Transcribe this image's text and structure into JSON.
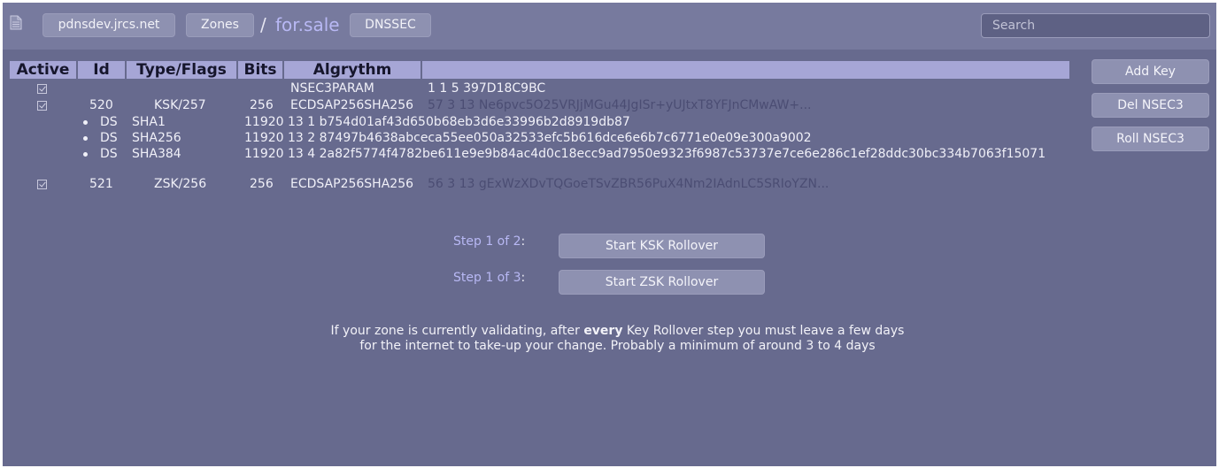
{
  "header": {
    "server_button": "pdnsdev.jrcs.net",
    "zones_button": "Zones",
    "separator": "/",
    "zone_name": "for.sale",
    "dnssec_button": "DNSSEC",
    "search_placeholder": "Search"
  },
  "table": {
    "columns": [
      "Active",
      "Id",
      "Type/Flags",
      "Bits",
      "Algrythm",
      ""
    ],
    "nsec3param": {
      "algorithm": "NSEC3PARAM",
      "value": "1 1 5 397D18C9BC"
    },
    "keys": [
      {
        "active": true,
        "id": "520",
        "type_flags": "KSK/257",
        "bits": "256",
        "algorithm": "ECDSAP256SHA256",
        "key": "57 3 13 Ne6pvc5O25VRJjMGu44JgISr+yUJtxT8YFJnCMwAW+...",
        "ds": [
          {
            "label": "DS",
            "digest_type": "SHA1",
            "value": "11920 13 1 b754d01af43d650b68eb3d6e33996b2d8919db87"
          },
          {
            "label": "DS",
            "digest_type": "SHA256",
            "value": "11920 13 2 87497b4638abceca55ee050a32533efc5b616dce6e6b7c6771e0e09e300a9002"
          },
          {
            "label": "DS",
            "digest_type": "SHA384",
            "value": "11920 13 4 2a82f5774f4782be611e9e9b84ac4d0c18ecc9ad7950e9323f6987c53737e7ce6e286c1ef28ddc30bc334b7063f15071"
          }
        ]
      },
      {
        "active": true,
        "id": "521",
        "type_flags": "ZSK/256",
        "bits": "256",
        "algorithm": "ECDSAP256SHA256",
        "key": "56 3 13 gExWzXDvTQGoeTSvZBR56PuX4Nm2IAdnLC5SRIoYZN..."
      }
    ]
  },
  "sidebar": {
    "add_key": "Add Key",
    "del_nsec3": "Del NSEC3",
    "roll_nsec3": "Roll NSEC3"
  },
  "rollover": {
    "ksk": {
      "step_label": "Step 1 of 2",
      "colon": ":",
      "button": "Start KSK Rollover"
    },
    "zsk": {
      "step_label": "Step 1 of 3",
      "colon": ":",
      "button": "Start ZSK Rollover"
    }
  },
  "note": {
    "before": "If your zone is currently validating, after ",
    "emphasis": "every",
    "after": " Key Rollover step you must leave a few days",
    "line2": "for the internet to take-up your change. Probably a minimum of around 3 to 4 days"
  },
  "colors": {
    "background": "#676a8e",
    "topbar": "#777a9e",
    "header_row": "#a6a6d6",
    "accent_text": "#b8b8f4",
    "key_text_dim": "#4b4d73"
  }
}
